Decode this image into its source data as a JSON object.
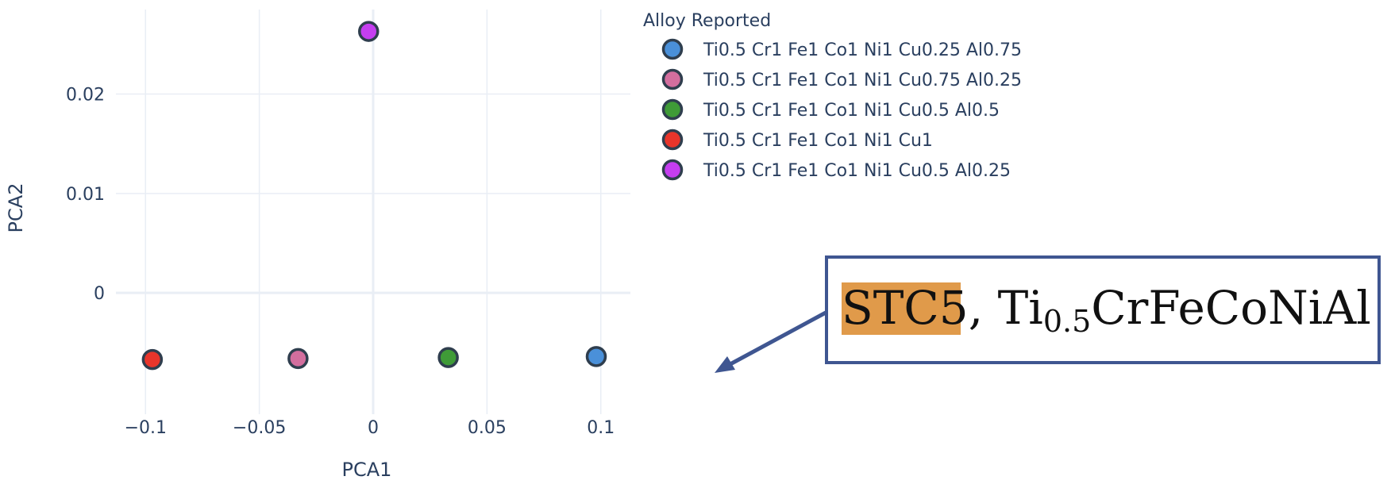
{
  "chart_data": {
    "type": "scatter",
    "xlabel": "PCA1",
    "ylabel": "PCA2",
    "xlim": [
      -0.113,
      0.113
    ],
    "ylim": [
      -0.0122,
      0.0285
    ],
    "x_ticks": [
      {
        "value": -0.1,
        "label": "−0.1"
      },
      {
        "value": -0.05,
        "label": "−0.05"
      },
      {
        "value": 0,
        "label": "0"
      },
      {
        "value": 0.05,
        "label": "0.05"
      },
      {
        "value": 0.1,
        "label": "0.1"
      }
    ],
    "y_ticks": [
      {
        "value": 0,
        "label": "0"
      },
      {
        "value": 0.01,
        "label": "0.01"
      },
      {
        "value": 0.02,
        "label": "0.02"
      }
    ],
    "grid": true,
    "legend_title": "Alloy Reported",
    "legend_position": "top-right",
    "series": [
      {
        "name": "Ti0.5 Cr1 Fe1 Co1 Ni1 Cu0.25 Al0.75",
        "color": "#4a90d9",
        "x": [
          0.098
        ],
        "y": [
          -0.0064
        ]
      },
      {
        "name": "Ti0.5 Cr1 Fe1 Co1 Ni1 Cu0.75 Al0.25",
        "color": "#d36e9e",
        "x": [
          -0.033
        ],
        "y": [
          -0.0066
        ]
      },
      {
        "name": "Ti0.5 Cr1 Fe1 Co1 Ni1 Cu0.5 Al0.5",
        "color": "#3f9b37",
        "x": [
          0.033
        ],
        "y": [
          -0.0065
        ]
      },
      {
        "name": "Ti0.5 Cr1 Fe1 Co1 Ni1 Cu1",
        "color": "#e8352b",
        "x": [
          -0.097
        ],
        "y": [
          -0.0067
        ]
      },
      {
        "name": "Ti0.5 Cr1 Fe1 Co1 Ni1 Cu0.5 Al0.25",
        "color": "#c53ef0",
        "x": [
          -0.002
        ],
        "y": [
          0.0263
        ]
      }
    ]
  },
  "callout": {
    "highlight": "STC5",
    "sep": ", ",
    "formula_before": "Ti",
    "subscript": "0.5",
    "formula_after": "CrFeCoNiAl",
    "highlight_color": "#e09a4a",
    "border_color": "#3f5691"
  }
}
